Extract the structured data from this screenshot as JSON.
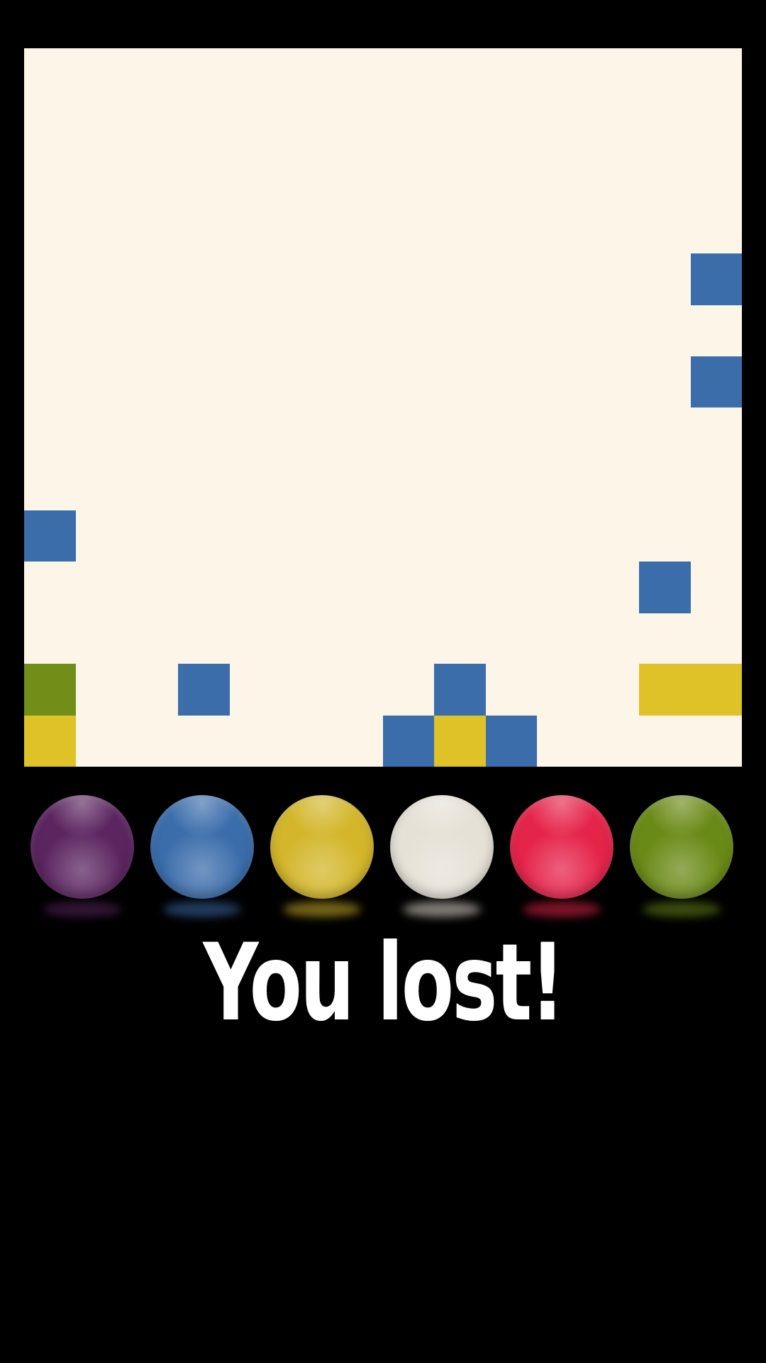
{
  "board": {
    "background": "#fcf5e8",
    "rows": 14,
    "cols": 14,
    "cells": [
      {
        "row": 4,
        "col": 13,
        "color": "blue"
      },
      {
        "row": 6,
        "col": 13,
        "color": "blue"
      },
      {
        "row": 9,
        "col": 0,
        "color": "blue"
      },
      {
        "row": 10,
        "col": 12,
        "color": "blue"
      },
      {
        "row": 12,
        "col": 0,
        "color": "green"
      },
      {
        "row": 12,
        "col": 3,
        "color": "blue"
      },
      {
        "row": 12,
        "col": 8,
        "color": "blue"
      },
      {
        "row": 12,
        "col": 12,
        "color": "yellow"
      },
      {
        "row": 12,
        "col": 13,
        "color": "yellow"
      },
      {
        "row": 13,
        "col": 0,
        "color": "yellow"
      },
      {
        "row": 13,
        "col": 7,
        "color": "blue"
      },
      {
        "row": 13,
        "col": 8,
        "color": "yellow"
      },
      {
        "row": 13,
        "col": 9,
        "color": "blue"
      }
    ]
  },
  "palette": {
    "blue": "#3b6dab",
    "yellow": "#dec227",
    "green": "#718e19",
    "purple": "#5b2560",
    "white": "#e6e1d6",
    "red": "#e5244a"
  },
  "balls": [
    {
      "name": "purple",
      "color": "#5b2560",
      "icon": "purple-ball-icon"
    },
    {
      "name": "blue",
      "color": "#3b6dab",
      "icon": "blue-ball-icon"
    },
    {
      "name": "yellow",
      "color": "#d3b62a",
      "icon": "yellow-ball-icon"
    },
    {
      "name": "white",
      "color": "#e6e1d6",
      "icon": "white-ball-icon"
    },
    {
      "name": "red",
      "color": "#e5244a",
      "icon": "red-ball-icon"
    },
    {
      "name": "green",
      "color": "#6a8a17",
      "icon": "green-ball-icon"
    }
  ],
  "status": {
    "message": "You lost!"
  }
}
